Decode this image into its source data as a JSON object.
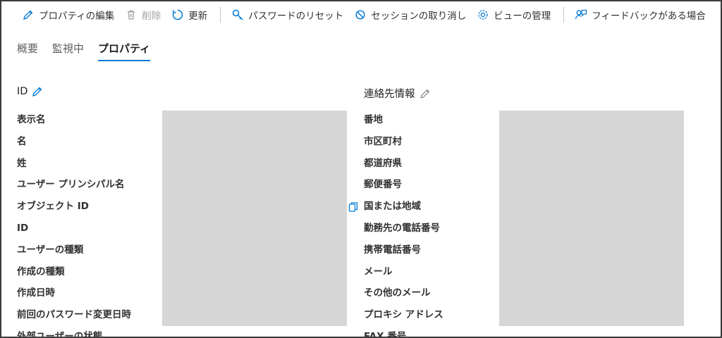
{
  "toolbar": {
    "edit_properties": "プロパティの編集",
    "delete": "削除",
    "refresh": "更新",
    "reset_password": "パスワードのリセット",
    "revoke_sessions": "セッションの取り消し",
    "manage_view": "ビューの管理",
    "feedback": "フィードバックがある場合"
  },
  "tabs": [
    "概要",
    "監視中",
    "プロパティ"
  ],
  "active_tab": "プロパティ",
  "identity": {
    "heading": "ID",
    "fields": [
      "表示名",
      "名",
      "姓",
      "ユーザー プリンシパル名",
      "オブジェクト ID",
      "ID",
      "ユーザーの種類",
      "作成の種類",
      "作成日時",
      "前回のパスワード変更日時",
      "外部ユーザーの状態"
    ]
  },
  "contact": {
    "heading": "連絡先情報",
    "fields": [
      "番地",
      "市区町村",
      "都道府県",
      "郵便番号",
      "国または地域",
      "勤務先の電話番号",
      "携帯電話番号",
      "メール",
      "その他のメール",
      "プロキシ アドレス",
      "FAX 番号"
    ]
  },
  "colors": {
    "accent": "#0078d4",
    "redaction": "#d6d6d6",
    "disabled": "#a19f9d"
  },
  "icons": [
    "pencil-icon",
    "trash-icon",
    "refresh-icon",
    "key-icon",
    "block-icon",
    "gear-icon",
    "feedback-icon",
    "copy-icon"
  ]
}
